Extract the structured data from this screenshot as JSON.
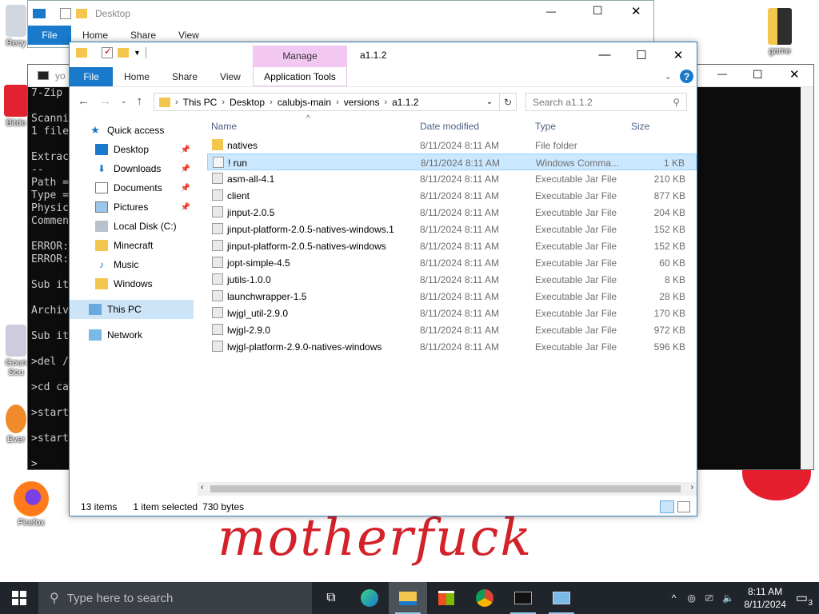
{
  "desktop": {
    "icons": [
      {
        "label": "Recy",
        "icon": "recycle-bin-icon"
      },
      {
        "label": "Bitde",
        "icon": "app-icon"
      },
      {
        "label": "Goun",
        "icon": "app-shortcut-icon"
      },
      {
        "label": "Sou",
        "icon": "app-shortcut-icon"
      },
      {
        "label": "Ever",
        "icon": "app-shortcut-icon"
      },
      {
        "label": "Firefox",
        "icon": "firefox-icon"
      },
      {
        "label": "game",
        "icon": "folder-icon"
      }
    ],
    "overlay_text": "motherfuck",
    "overlay_color": "#d3222a"
  },
  "back_window": {
    "title": "Desktop",
    "ribbon_tabs": [
      "File",
      "Home",
      "Share",
      "View"
    ]
  },
  "cmd_window": {
    "title": "yo",
    "lines": [
      "7-Zip",
      "",
      "Scanni",
      "1 file",
      "",
      "Extrac",
      "--",
      "Path =",
      "Type =",
      "Physic",
      "Commen",
      "",
      "ERROR:",
      "ERROR:",
      "",
      "Sub it",
      "",
      "Archiv",
      "",
      "Sub it",
      "",
      ">del /",
      "",
      ">cd ca",
      "",
      ">start",
      "",
      ">start",
      "",
      ">"
    ]
  },
  "main_window": {
    "title": "a1.1.2",
    "manage_tab": "Manage",
    "app_tools": "Application Tools",
    "ribbon_tabs": [
      "File",
      "Home",
      "Share",
      "View"
    ],
    "breadcrumb": [
      "This PC",
      "Desktop",
      "calubjs-main",
      "versions",
      "a1.1.2"
    ],
    "search_placeholder": "Search a1.1.2",
    "nav": [
      {
        "label": "Quick access",
        "icon": "star-icon",
        "pinned": false
      },
      {
        "label": "Desktop",
        "icon": "desktop-icon",
        "pinned": true
      },
      {
        "label": "Downloads",
        "icon": "downloads-icon",
        "pinned": true
      },
      {
        "label": "Documents",
        "icon": "documents-icon",
        "pinned": true
      },
      {
        "label": "Pictures",
        "icon": "pictures-icon",
        "pinned": true
      },
      {
        "label": "Local Disk (C:)",
        "icon": "disk-icon",
        "pinned": false
      },
      {
        "label": "Minecraft",
        "icon": "folder-icon",
        "pinned": false
      },
      {
        "label": "Music",
        "icon": "music-icon",
        "pinned": false
      },
      {
        "label": "Windows",
        "icon": "folder-icon",
        "pinned": false
      },
      {
        "label": "This PC",
        "icon": "pc-icon",
        "pinned": false
      },
      {
        "label": "Network",
        "icon": "network-icon",
        "pinned": false
      }
    ],
    "columns": [
      "Name",
      "Date modified",
      "Type",
      "Size"
    ],
    "files": [
      {
        "name": "natives",
        "date": "8/11/2024 8:11 AM",
        "type": "File folder",
        "size": "",
        "icon": "folder-icon"
      },
      {
        "name": "! run",
        "date": "8/11/2024 8:11 AM",
        "type": "Windows Comma...",
        "size": "1 KB",
        "icon": "batch-file-icon"
      },
      {
        "name": "asm-all-4.1",
        "date": "8/11/2024 8:11 AM",
        "type": "Executable Jar File",
        "size": "210 KB",
        "icon": "jar-icon"
      },
      {
        "name": "client",
        "date": "8/11/2024 8:11 AM",
        "type": "Executable Jar File",
        "size": "877 KB",
        "icon": "jar-icon"
      },
      {
        "name": "jinput-2.0.5",
        "date": "8/11/2024 8:11 AM",
        "type": "Executable Jar File",
        "size": "204 KB",
        "icon": "jar-icon"
      },
      {
        "name": "jinput-platform-2.0.5-natives-windows.1",
        "date": "8/11/2024 8:11 AM",
        "type": "Executable Jar File",
        "size": "152 KB",
        "icon": "jar-icon"
      },
      {
        "name": "jinput-platform-2.0.5-natives-windows",
        "date": "8/11/2024 8:11 AM",
        "type": "Executable Jar File",
        "size": "152 KB",
        "icon": "jar-icon"
      },
      {
        "name": "jopt-simple-4.5",
        "date": "8/11/2024 8:11 AM",
        "type": "Executable Jar File",
        "size": "60 KB",
        "icon": "jar-icon"
      },
      {
        "name": "jutils-1.0.0",
        "date": "8/11/2024 8:11 AM",
        "type": "Executable Jar File",
        "size": "8 KB",
        "icon": "jar-icon"
      },
      {
        "name": "launchwrapper-1.5",
        "date": "8/11/2024 8:11 AM",
        "type": "Executable Jar File",
        "size": "28 KB",
        "icon": "jar-icon"
      },
      {
        "name": "lwjgl_util-2.9.0",
        "date": "8/11/2024 8:11 AM",
        "type": "Executable Jar File",
        "size": "170 KB",
        "icon": "jar-icon"
      },
      {
        "name": "lwjgl-2.9.0",
        "date": "8/11/2024 8:11 AM",
        "type": "Executable Jar File",
        "size": "972 KB",
        "icon": "jar-icon"
      },
      {
        "name": "lwjgl-platform-2.9.0-natives-windows",
        "date": "8/11/2024 8:11 AM",
        "type": "Executable Jar File",
        "size": "596 KB",
        "icon": "jar-icon"
      }
    ],
    "selected_index": 1,
    "status": {
      "items": "13 items",
      "selected": "1 item selected",
      "size": "730 bytes"
    }
  },
  "taskbar": {
    "search_placeholder": "Type here to search",
    "apps": [
      "task-view-icon",
      "edge-icon",
      "file-explorer-icon",
      "store-icon",
      "chrome-icon",
      "cmd-icon",
      "control-panel-icon"
    ],
    "time": "8:11 AM",
    "date": "8/11/2024",
    "notification_count": "3"
  },
  "colors": {
    "accent": "#1979ca",
    "selection": "#cce8ff",
    "manage": "#f2c8f2",
    "taskbar": "#20252b"
  }
}
